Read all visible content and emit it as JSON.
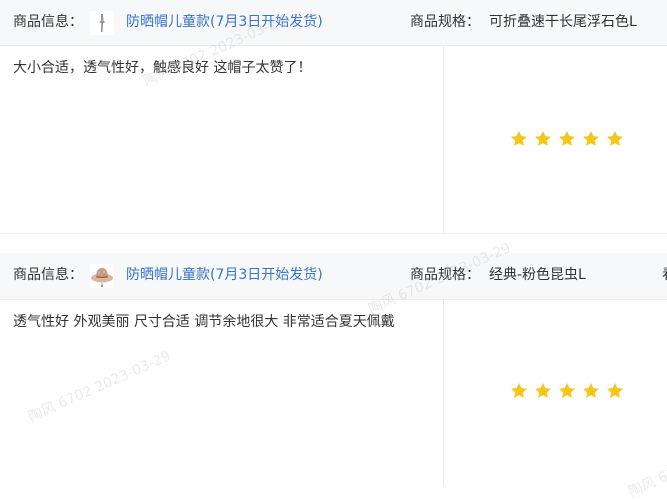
{
  "reviews": [
    {
      "product_label": "商品信息：",
      "product_name": "防晒帽儿童款(7月3日开始发货)",
      "thumbnail_icon": "hat-product-thumbnail",
      "spec_label": "商品规格：",
      "spec_value": "可折叠速干长尾浮石色L",
      "comment": "大小合适，透气性好，触感良好 这帽子太赞了！",
      "rating": 5,
      "rating_max": 5
    },
    {
      "product_label": "商品信息：",
      "product_name": "防晒帽儿童款(7月3日开始发货)",
      "thumbnail_icon": "hat-product-thumbnail",
      "spec_label": "商品规格：",
      "spec_value": "经典-粉色昆虫L",
      "spec_extra": "看",
      "comment": "透气性好 外观美丽 尺寸合适 调节余地很大 非常适合夏天佩戴",
      "rating": 5,
      "rating_max": 5
    }
  ],
  "watermark": {
    "text": "陶风 6702 2023-03-29"
  },
  "colors": {
    "link": "#3773c8",
    "star": "#f5c518",
    "header_bg": "#f7f8fa",
    "border": "#ececec"
  }
}
